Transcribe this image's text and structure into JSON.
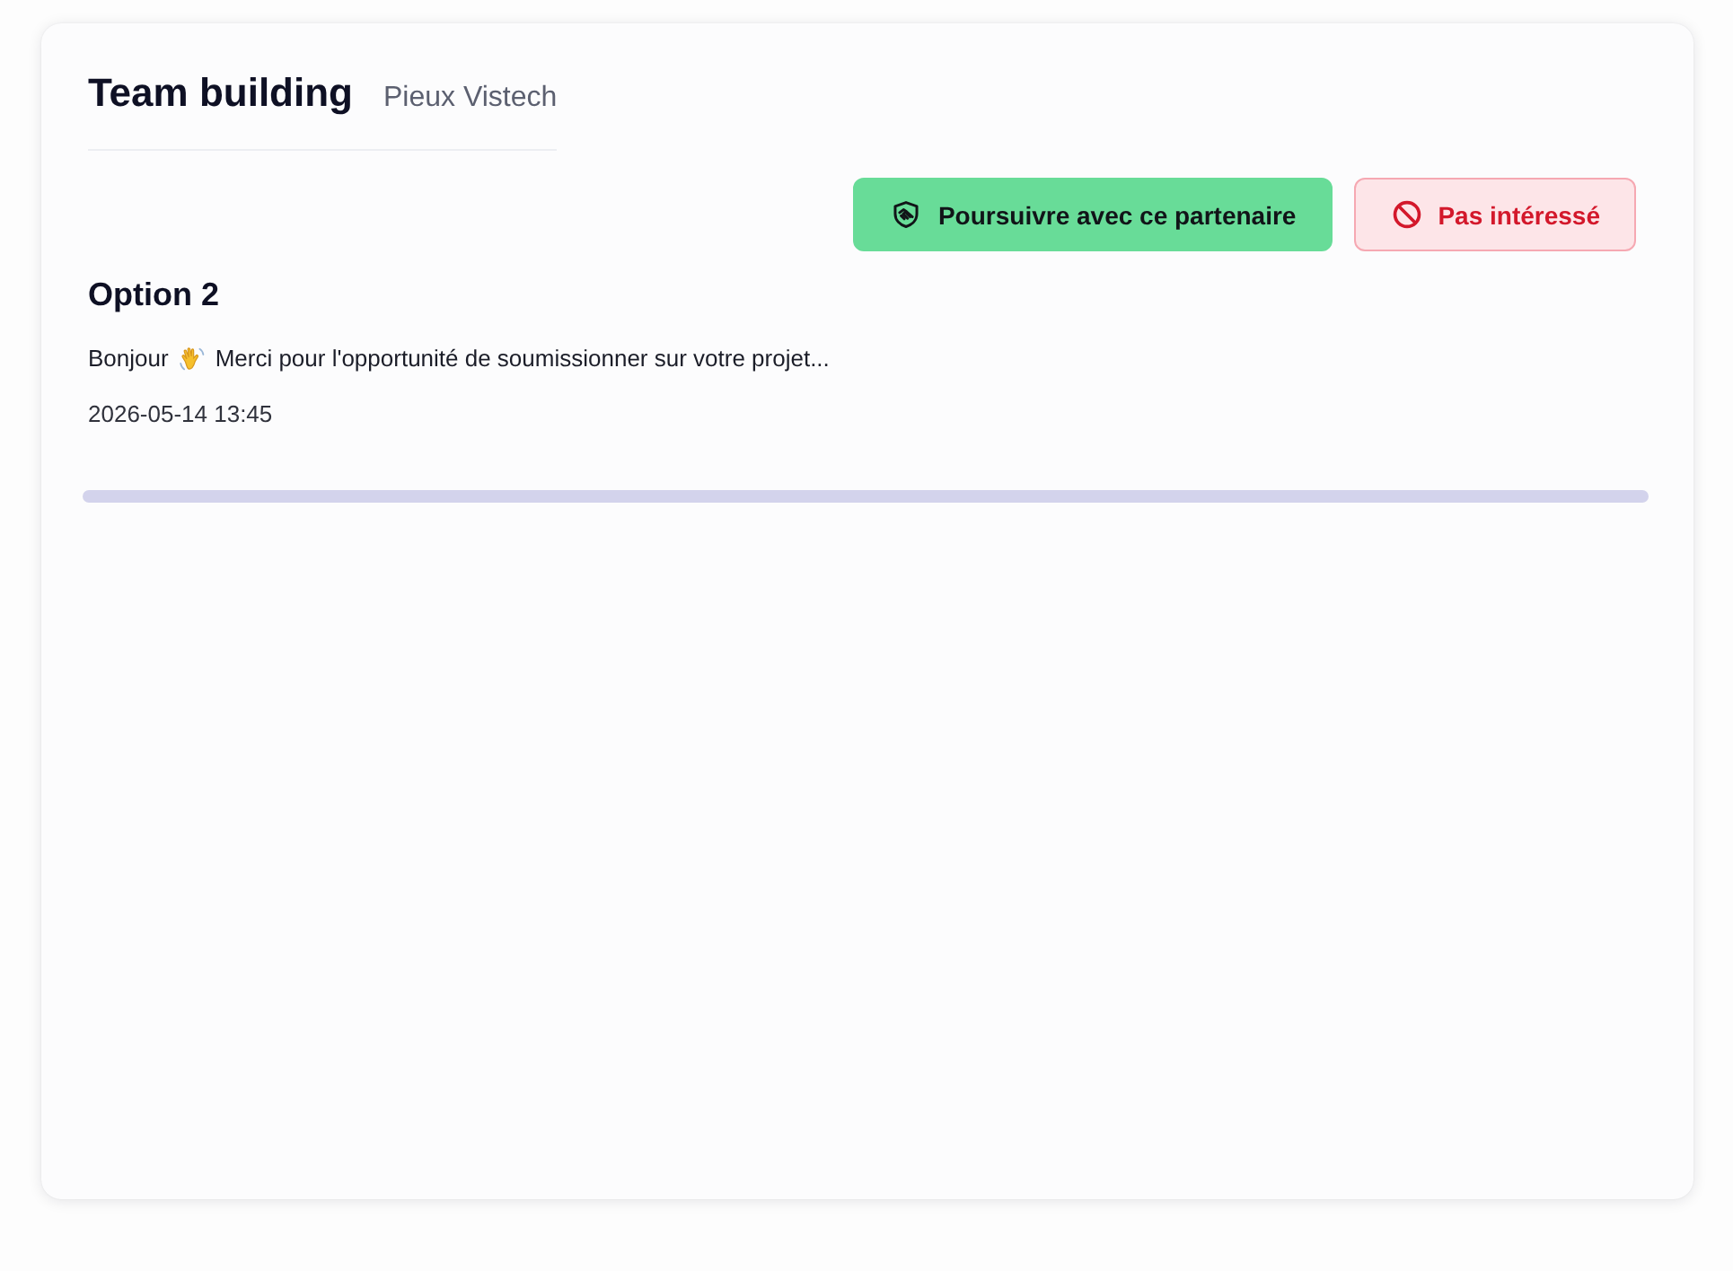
{
  "header": {
    "title": "Team building",
    "subtitle": "Pieux Vistech"
  },
  "actions": [
    {
      "label": "Poursuivre avec ce partenaire",
      "kind": "accept"
    },
    {
      "label": "Pas intéressé",
      "kind": "decline"
    }
  ],
  "option": {
    "title": "Option 2",
    "greeting": "Bonjour",
    "message": "Merci pour l'opportunité de soumissionner sur votre projet...",
    "date": "2026-05-14 13:45"
  }
}
